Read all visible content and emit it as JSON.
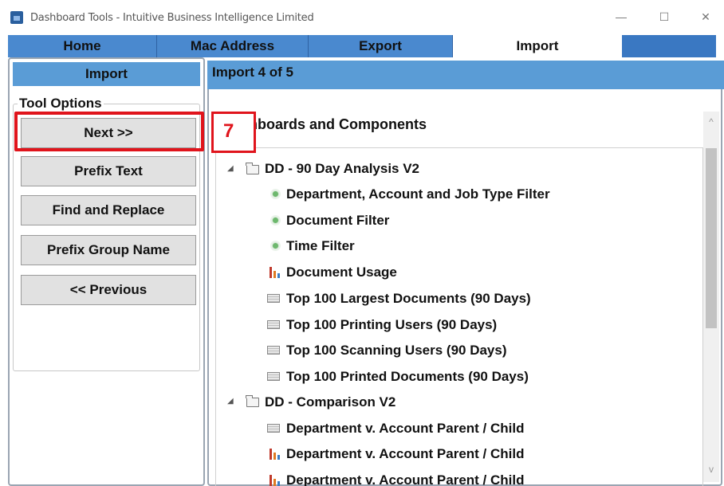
{
  "window": {
    "title": "Dashboard Tools - Intuitive Business Intelligence Limited",
    "minimize": "—",
    "maximize": "☐",
    "close": "✕"
  },
  "tabs": [
    {
      "label": "Home",
      "active": false
    },
    {
      "label": "Mac Address",
      "active": false
    },
    {
      "label": "Export",
      "active": false
    },
    {
      "label": "Import",
      "active": true
    }
  ],
  "sidebar": {
    "header": "Import",
    "group_label": "Tool Options",
    "buttons": [
      {
        "label": "Next >>"
      },
      {
        "label": "Prefix Text"
      },
      {
        "label": "Find and Replace"
      },
      {
        "label": "Prefix Group Name"
      },
      {
        "label": "<< Previous"
      }
    ]
  },
  "main": {
    "header": "Import 4 of 5",
    "section_title": "ashboards and Components",
    "badge": "7",
    "tree": [
      {
        "label": "DD - 90 Day Analysis V2",
        "type": "folder",
        "expander": "◢"
      },
      {
        "label": "Department, Account and Job Type Filter",
        "type": "filter"
      },
      {
        "label": "Document Filter",
        "type": "filter"
      },
      {
        "label": "Time Filter",
        "type": "filter"
      },
      {
        "label": "Document Usage",
        "type": "chart"
      },
      {
        "label": "Top 100 Largest Documents (90 Days)",
        "type": "table"
      },
      {
        "label": "Top 100 Printing Users (90 Days)",
        "type": "table"
      },
      {
        "label": "Top 100 Scanning Users (90 Days)",
        "type": "table"
      },
      {
        "label": "Top 100 Printed Documents (90 Days)",
        "type": "table"
      },
      {
        "label": "DD - Comparison V2",
        "type": "folder",
        "expander": "◢"
      },
      {
        "label": "Department v. Account Parent / Child",
        "type": "table"
      },
      {
        "label": "Department v. Account Parent / Child",
        "type": "chart"
      },
      {
        "label": "Department v. Account Parent / Child",
        "type": "chart"
      }
    ],
    "scroll_up": "^",
    "scroll_down": "v"
  },
  "colors": {
    "tab_bar": "#3a78c2",
    "panel_header": "#5a9cd6",
    "highlight": "#e0141c"
  }
}
